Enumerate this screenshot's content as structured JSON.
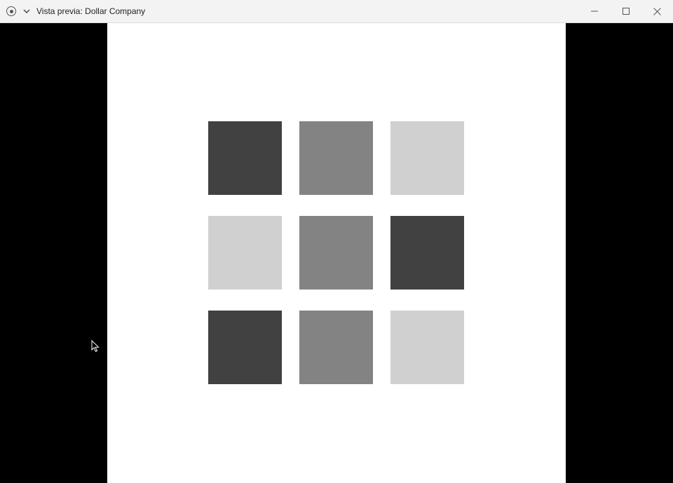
{
  "window": {
    "title": "Vista previa: Dollar Company",
    "icon": "record-icon",
    "controls": [
      "minimize-icon",
      "maximize-icon",
      "close-icon"
    ]
  },
  "preview": {
    "tiles": [
      {
        "color": "#414141"
      },
      {
        "color": "#838383"
      },
      {
        "color": "#d0d0d0"
      },
      {
        "color": "#d0d0d0"
      },
      {
        "color": "#838383"
      },
      {
        "color": "#414141"
      },
      {
        "color": "#414141"
      },
      {
        "color": "#838383"
      },
      {
        "color": "#d0d0d0"
      }
    ]
  },
  "colors": {
    "titlebar_bg": "#f3f3f3",
    "surround_bg": "#000000",
    "page_bg": "#ffffff"
  }
}
